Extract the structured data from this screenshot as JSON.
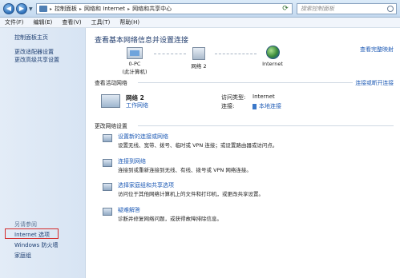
{
  "address_bar": {
    "crumbs": [
      "控制面板",
      "网络和 Internet",
      "网络和共享中心"
    ],
    "search_placeholder": "搜索控制面板"
  },
  "menu": [
    "文件(F)",
    "编辑(E)",
    "查看(V)",
    "工具(T)",
    "帮助(H)"
  ],
  "sidebar": {
    "home": "控制面板主页",
    "links": [
      "更改适配器设置",
      "更改高级共享设置"
    ],
    "see_also_header": "另请参阅",
    "see_also": [
      "Internet 选项",
      "Windows 防火墙",
      "家庭组"
    ]
  },
  "main": {
    "title": "查看基本网络信息并设置连接",
    "full_map": "查看完整映射",
    "map": {
      "pc_label": "0-PC",
      "pc_sub": "(此计算机)",
      "network_label": "网络  2",
      "internet_label": "Internet"
    },
    "active_section": {
      "label": "查看活动网络",
      "right_link": "连接或断开连接",
      "network_name": "网络  2",
      "network_type": "工作网络",
      "access_label": "访问类型:",
      "access_value": "Internet",
      "connection_label": "连接:",
      "connection_value": "本地连接"
    },
    "settings_section": {
      "label": "更改网络设置",
      "tasks": [
        {
          "title": "设置新的连接或网络",
          "desc": "设置无线、宽带、拨号、临时或 VPN 连接；或设置路由器或访问点。"
        },
        {
          "title": "连接到网络",
          "desc": "连接到或重新连接到无线、有线、拨号或 VPN 网络连接。"
        },
        {
          "title": "选择家庭组和共享选项",
          "desc": "访问位于其他网络计算机上的文件和打印机，或更改共享设置。"
        },
        {
          "title": "疑难解答",
          "desc": "诊断并修复网络问题，或获得故障排除信息。"
        }
      ]
    }
  }
}
